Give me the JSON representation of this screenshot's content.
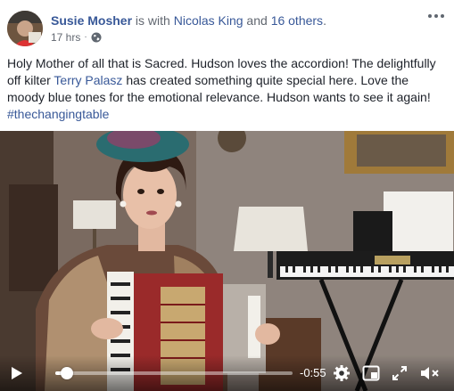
{
  "header": {
    "author": "Susie Mosher",
    "with_text": " is with ",
    "tagged": "Nicolas King",
    "and_text": " and ",
    "others": "16 others",
    "period": ".",
    "timestamp": "17 hrs",
    "separator": "·"
  },
  "post": {
    "text_before_link": "Holy Mother of all that is Sacred. Hudson loves the accordion! The delightfully off kilter ",
    "link_name": "Terry Palasz",
    "text_after_link": " has created something quite special here. Love the moody blue tones for the emotional relevance. Hudson wants to see it again!",
    "hashtag": "#thechangingtable"
  },
  "video": {
    "time_remaining": "-0:55",
    "progress": 0.05
  },
  "icons": {
    "globe": "globe-icon",
    "more": "more-options-icon",
    "play": "play-icon",
    "settings": "gear-icon",
    "pip": "picture-in-picture-icon",
    "fullscreen": "fullscreen-icon",
    "mute": "muted-speaker-icon"
  },
  "colors": {
    "link": "#385898",
    "text": "#1d2129",
    "meta": "#616770"
  }
}
